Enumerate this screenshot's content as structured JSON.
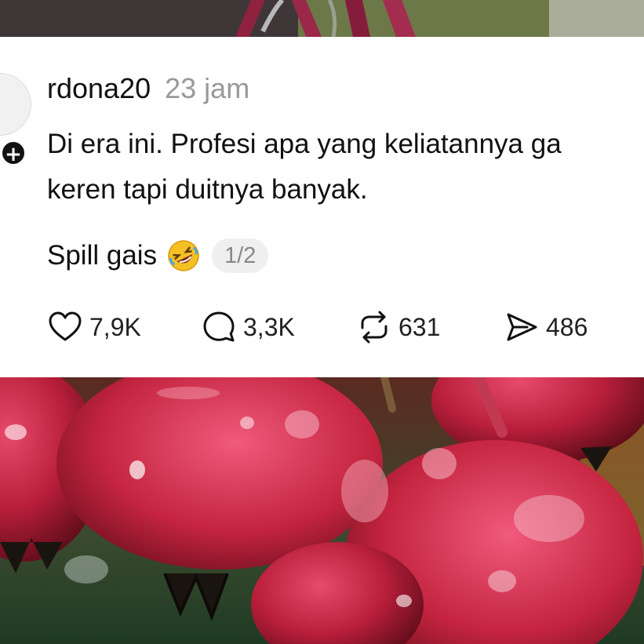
{
  "post": {
    "username": "rdona20",
    "timestamp": "23 jam",
    "text_line1": "Di era ini. Profesi apa yang keliatannya ga",
    "text_line2": "keren tapi duitnya banyak.",
    "spill_text": "Spill gais",
    "emoji": "rolling-on-floor-laughing-emoji",
    "page_indicator": "1/2",
    "follow_symbol": "+"
  },
  "actions": {
    "likes": "7,9K",
    "comments": "3,3K",
    "reposts": "631",
    "shares": "486"
  },
  "icons": {
    "like": "heart-icon",
    "comment": "comment-bubble-icon",
    "repost": "repost-icon",
    "share": "send-icon"
  },
  "colors": {
    "card_background": "#ffffff",
    "timestamp": "#999999",
    "text": "#111111",
    "pill_background": "#efefef"
  }
}
